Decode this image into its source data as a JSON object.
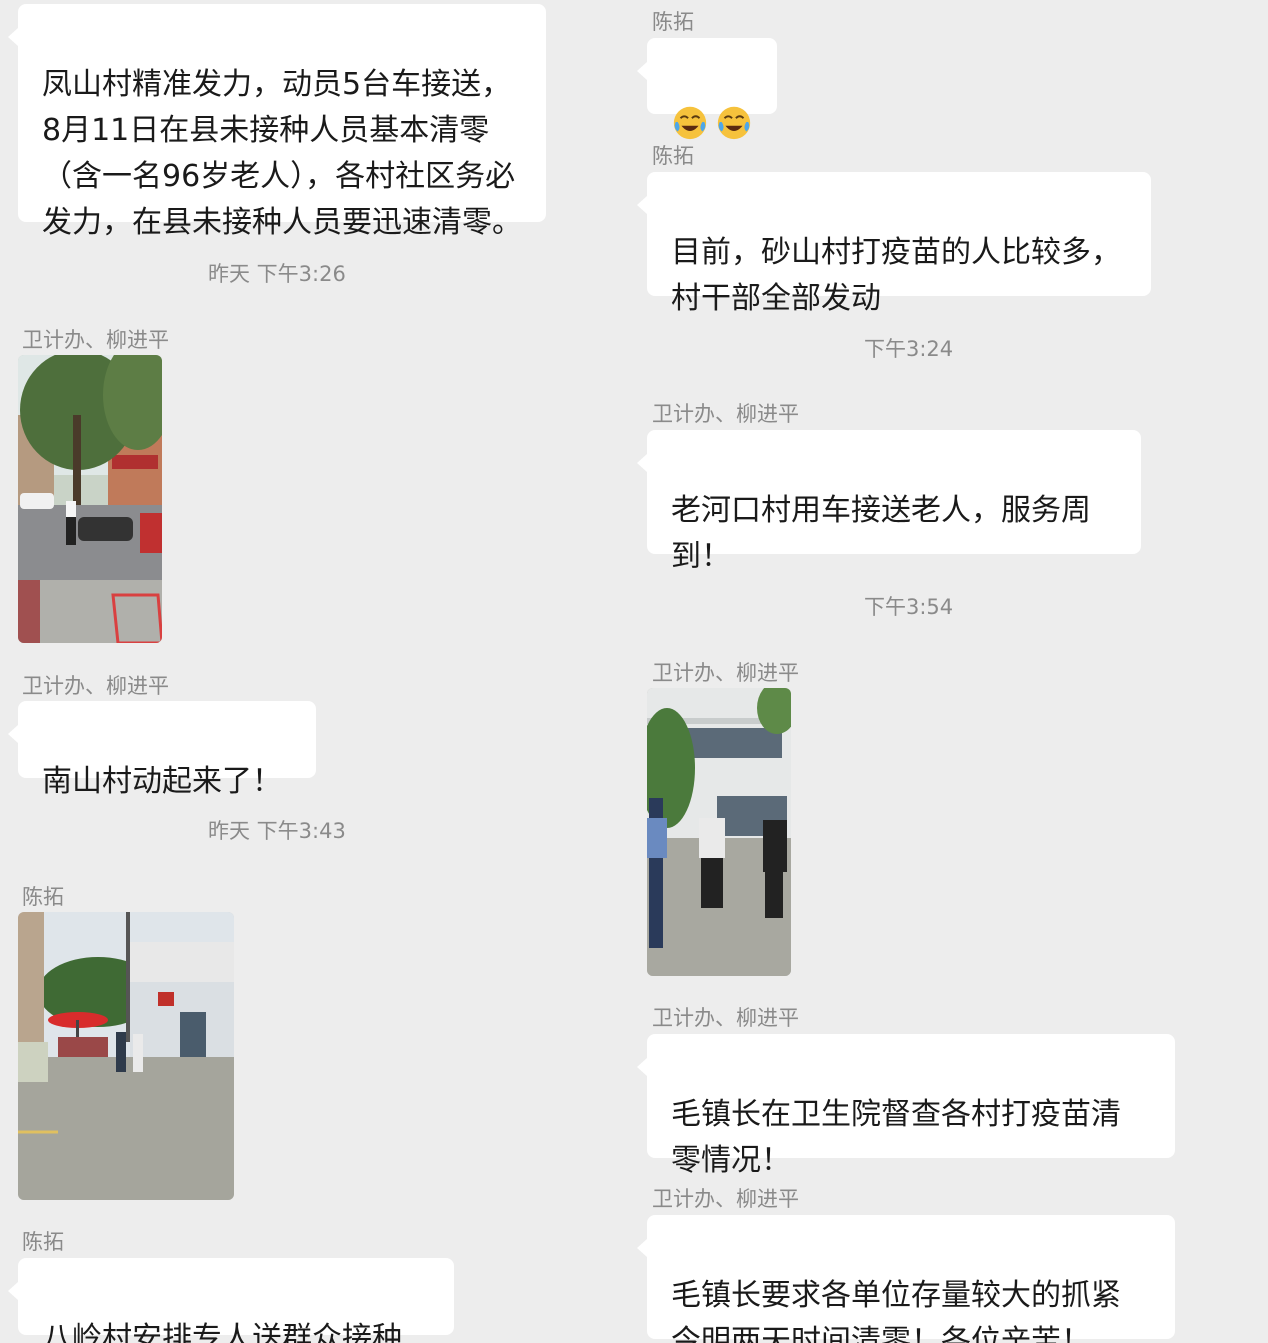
{
  "left": {
    "msg1": "凤山村精准发力，动员5台车接送，\n8月11日在县未接种人员基本清零\n（含一名96岁老人），各村社区务必\n发力，在县未接种人员要迅速清零。",
    "time1": "昨天 下午3:26",
    "sender1": "卫计办、柳进平",
    "sender2": "卫计办、柳进平",
    "msg2": "南山村动起来了！",
    "time2": "昨天 下午3:43",
    "sender3": "陈拓",
    "sender4": "陈拓",
    "msg3": "八岭村安排专人送群众接种"
  },
  "right": {
    "sender1": "陈拓",
    "emoji_names": [
      "face-with-tears-of-joy",
      "face-with-tears-of-joy"
    ],
    "sender2": "陈拓",
    "msg1": "目前，砂山村打疫苗的人比较多，\n村干部全部发动",
    "time1": "下午3:24",
    "sender3": "卫计办、柳进平",
    "msg2": "老河口村用车接送老人，服务周\n到！",
    "time2": "下午3:54",
    "sender4": "卫计办、柳进平",
    "sender5": "卫计办、柳进平",
    "msg3": "毛镇长在卫生院督查各村打疫苗清\n零情况！",
    "sender6": "卫计办、柳进平",
    "msg4": "毛镇长要求各单位存量较大的抓紧\n今明两天时间清零！各位辛苦！"
  },
  "colors": {
    "background": "#ededed",
    "bubble": "#ffffff",
    "meta_text": "#8a8a8a"
  }
}
